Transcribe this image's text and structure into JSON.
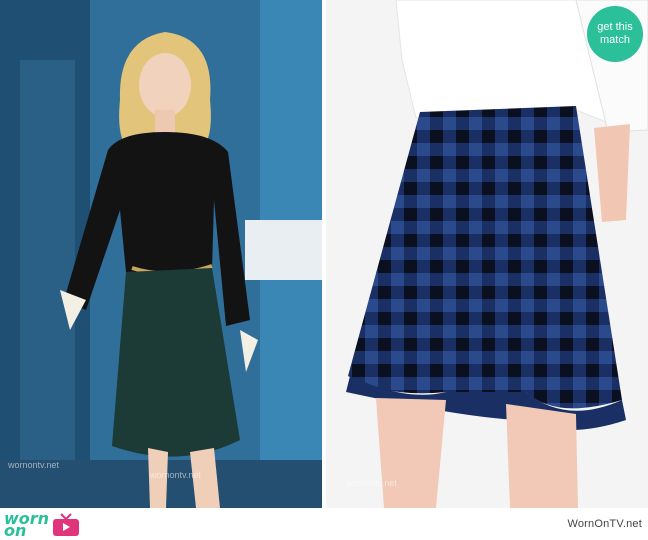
{
  "badge": {
    "line1": "get this",
    "line2": "match"
  },
  "footer": {
    "brand_line1": "worn",
    "brand_line2": "on",
    "credit": "WornOnTV.net"
  },
  "watermark": "wornontv.net"
}
